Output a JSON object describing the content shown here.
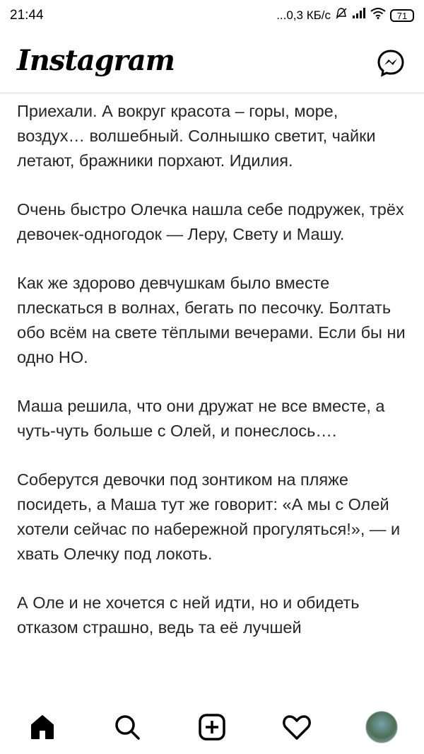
{
  "status_bar": {
    "time": "21:44",
    "network": "...0,3 КБ/с",
    "battery": "71"
  },
  "header": {
    "logo": "Instagram",
    "messenger_icon": "messenger-icon"
  },
  "post": {
    "paragraphs": [
      "Приехали. А вокруг красота – горы, море, воздух… волшебный. Солнышко светит, чайки летают, бражники порхают. Идилия.",
      "Очень быстро Олечка нашла себе подружек, трёх девочек-одногодок — Леру, Свету и Машу.",
      "Как же здорово девчушкам было вместе плескаться в волнах, бегать по песочку. Болтать обо всём на свете тёплыми вечерами. Если бы ни одно НО.",
      "Маша решила, что они дружат не все вместе, а чуть-чуть больше с Олей, и понеслось….",
      "Соберутся девочки под зонтиком на пляже посидеть, а Маша тут же говорит: «А мы с Олей хотели сейчас по набережной прогуляться!», — и хвать Олечку под локоть.",
      "А Оле и не хочется с ней идти, но и обидеть отказом страшно, ведь та её лучшей"
    ]
  },
  "navbar": {
    "items": [
      "home-icon",
      "search-icon",
      "new-post-icon",
      "activity-heart-icon",
      "profile-avatar"
    ]
  }
}
